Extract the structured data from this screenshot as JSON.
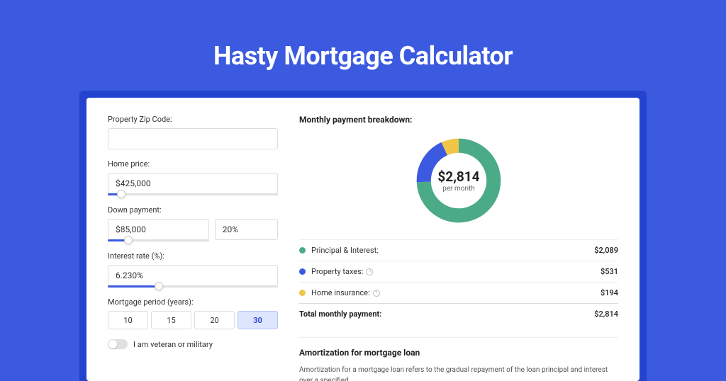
{
  "title": "Hasty Mortgage Calculator",
  "form": {
    "zip_label": "Property Zip Code:",
    "zip_value": "",
    "home_price_label": "Home price:",
    "home_price_value": "$425,000",
    "home_price_slider_pct": 8,
    "down_payment_label": "Down payment:",
    "down_payment_amount": "$85,000",
    "down_payment_pct": "20%",
    "down_payment_slider_pct": 20,
    "interest_label": "Interest rate (%):",
    "interest_value": "6.230%",
    "interest_slider_pct": 30,
    "period_label": "Mortgage period (years):",
    "periods": [
      "10",
      "15",
      "20",
      "30"
    ],
    "period_selected": "30",
    "veteran_label": "I am veteran or military"
  },
  "breakdown": {
    "title": "Monthly payment breakdown:",
    "total_amount": "$2,814",
    "per_month": "per month",
    "items": [
      {
        "label": "Principal & Interest:",
        "value": "$2,089",
        "color": "#4bab87",
        "has_info": false
      },
      {
        "label": "Property taxes:",
        "value": "$531",
        "color": "#3b5ae0",
        "has_info": true
      },
      {
        "label": "Home insurance:",
        "value": "$194",
        "color": "#f0c548",
        "has_info": true
      }
    ],
    "total_label": "Total monthly payment:",
    "total_value": "$2,814"
  },
  "amort": {
    "title": "Amortization for mortgage loan",
    "text": "Amortization for a mortgage loan refers to the gradual repayment of the loan principal and interest over a specified"
  },
  "chart_data": {
    "type": "pie",
    "title": "Monthly payment breakdown",
    "series": [
      {
        "name": "Principal & Interest",
        "value": 2089,
        "color": "#4bab87"
      },
      {
        "name": "Property taxes",
        "value": 531,
        "color": "#3b5ae0"
      },
      {
        "name": "Home insurance",
        "value": 194,
        "color": "#f0c548"
      }
    ],
    "total": 2814,
    "center_label": "$2,814",
    "center_sublabel": "per month"
  }
}
